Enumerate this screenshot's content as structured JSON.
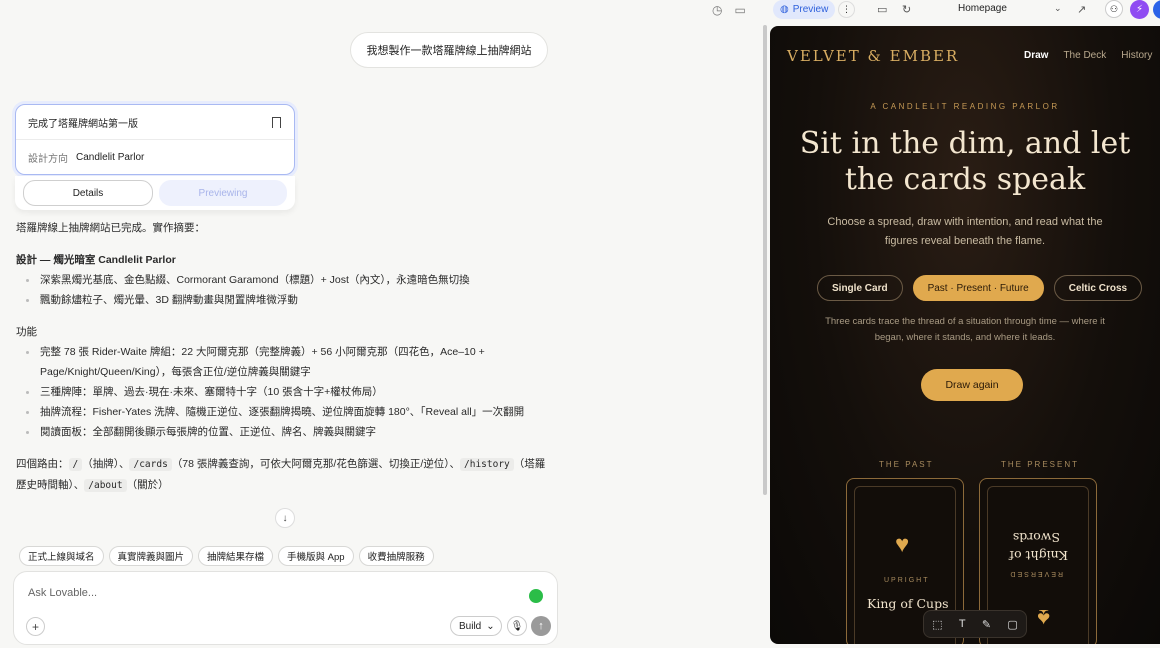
{
  "user_message": "我想製作一款塔羅牌線上抽牌網站",
  "version_card": {
    "title": "完成了塔羅牌網站第一版",
    "direction_label": "設計方向",
    "direction_value": "Candlelit Parlor",
    "details_label": "Details",
    "previewing_label": "Previewing"
  },
  "summary": {
    "intro": "塔羅牌線上抽牌網站已完成。實作摘要：",
    "design_title": "設計 — 燭光暗室 Candlelit Parlor",
    "design_items": [
      "深紫黑燭光基底、金色點綴、Cormorant Garamond（標題）+ Jost（內文），永遠暗色無切換",
      "飄動餘燼粒子、燭光暈、3D 翻牌動畫與閒置牌堆微浮動"
    ],
    "features_title": "功能",
    "feature_items": [
      "完整 78 張 Rider-Waite 牌組：22 大阿爾克那（完整牌義）+ 56 小阿爾克那（四花色，Ace–10 + Page/Knight/Queen/King），每張含正位/逆位牌義與關鍵字",
      "三種牌陣：單牌、過去·現在·未來、塞爾特十字（10 張含十字+權杖佈局）",
      "抽牌流程：Fisher-Yates 洗牌、隨機正逆位、逐張翻牌揭曉、逆位牌面旋轉 180°、「Reveal all」一次翻開",
      "閱讀面板：全部翻開後顯示每張牌的位置、正逆位、牌名、牌義與關鍵字"
    ],
    "routes_text_1": "四個路由：",
    "route_1": "/",
    "route_1_desc": "（抽牌）、",
    "route_2": "/cards",
    "route_2_desc": "（78 張牌義查詢，可依大阿爾克那/花色篩選、切換正/逆位）、",
    "route_3": "/history",
    "route_3_desc": "（塔羅歷史時間軸）、",
    "route_4": "/about",
    "route_4_desc": "（關於）"
  },
  "suggestions": [
    "正式上線與域名",
    "真實牌義與圖片",
    "抽牌結果存檔",
    "手機版與 App",
    "收費抽牌服務"
  ],
  "composer": {
    "placeholder": "Ask Lovable...",
    "mode_label": "Build"
  },
  "topbar": {
    "preview_label": "Preview",
    "page_name": "Homepage"
  },
  "site": {
    "brand": "VELVET & EMBER",
    "nav": [
      "Draw",
      "The Deck",
      "History"
    ],
    "eyebrow": "A CANDLELIT READING PARLOR",
    "hero_line1": "Sit in the dim, and let",
    "hero_line2": "the cards speak",
    "subtitle": "Choose a spread, draw with intention, and read what the figures reveal beneath the flame.",
    "spreads": [
      "Single Card",
      "Past · Present · Future",
      "Celtic Cross"
    ],
    "spread_desc": "Three cards trace the thread of a situation through time — where it began, where it stands, and where it leads.",
    "draw_again": "Draw again",
    "positions": [
      "THE PAST",
      "THE PRESENT"
    ],
    "card1": {
      "orientation": "UPRIGHT",
      "name": "King of Cups"
    },
    "card2": {
      "orientation": "REVERSED",
      "name_line1": "Knight of",
      "name_line2": "Swords"
    }
  },
  "colors": {
    "accent_gold": "#e0a94e",
    "site_bg": "#140f0b",
    "preview_blue": "#2d5fdb"
  }
}
